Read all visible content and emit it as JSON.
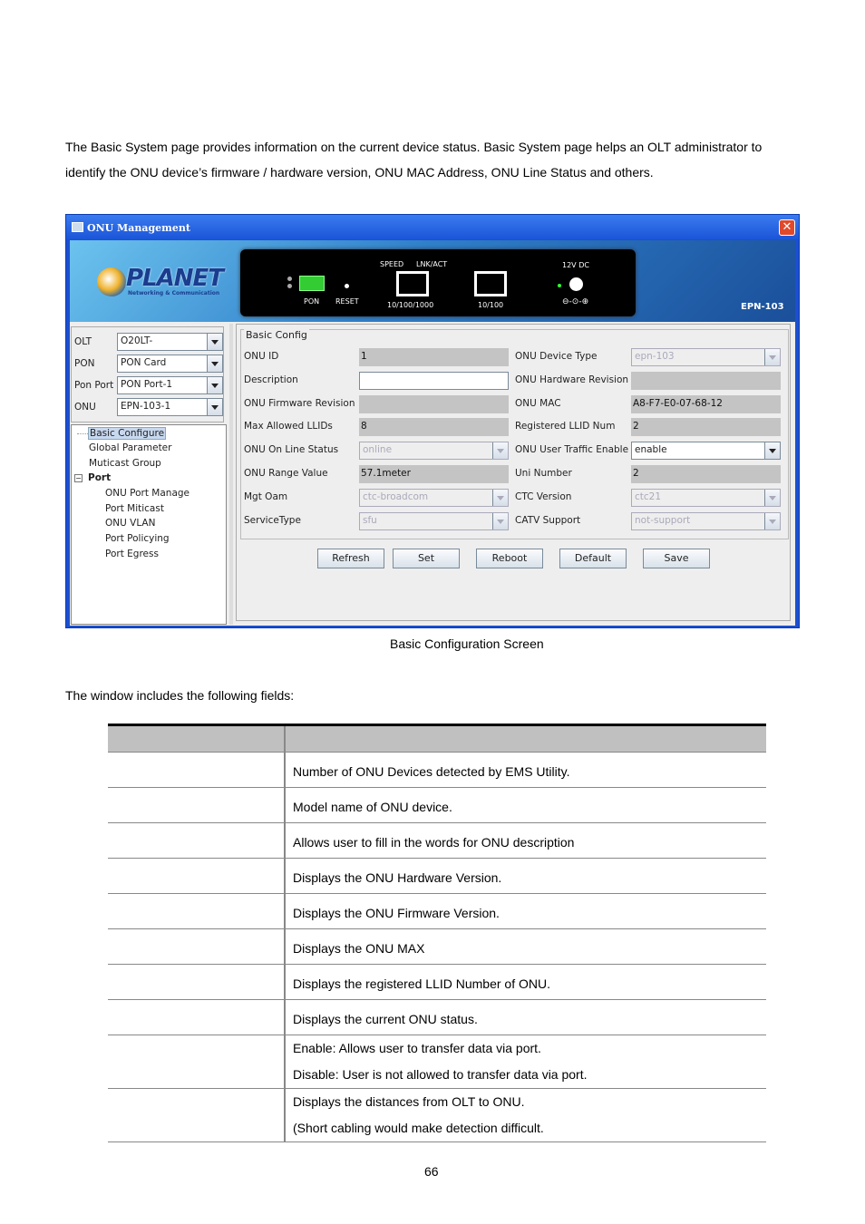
{
  "intro": {
    "line1": "The Basic System page provides information on the current device status. Basic System page helps an OLT administrator to",
    "line2": "identify the ONU device’s firmware / hardware version, ONU MAC Address, ONU Line Status and others."
  },
  "window": {
    "title": "ONU Management",
    "logo": {
      "brand": "PLANET",
      "tagline": "Networking & Communication"
    },
    "device": {
      "speed": "SPEED",
      "lnkact": "LNK/ACT",
      "pon": "PON",
      "reset": "RESET",
      "port1": "10/100/1000",
      "port2": "10/100",
      "power": "12V DC",
      "polarity": "⊖-⊙-⊕",
      "model": "EPN-103"
    },
    "selectors": [
      {
        "label": "OLT",
        "value": "O20LT-"
      },
      {
        "label": "PON",
        "value": "PON Card"
      },
      {
        "label": "Pon Port",
        "value": "PON Port-1"
      },
      {
        "label": "ONU",
        "value": "EPN-103-1"
      }
    ],
    "tree": {
      "basic": "Basic Configure",
      "global": "Global Parameter",
      "multicast": "Muticast Group",
      "port": "Port",
      "children": [
        "ONU Port Manage",
        "Port Miticast",
        "ONU VLAN",
        "Port Policying",
        "Port Egress"
      ]
    },
    "config": {
      "title": "Basic Config",
      "left": [
        {
          "label": "ONU ID",
          "value": "1",
          "type": "ro"
        },
        {
          "label": "Description",
          "value": "",
          "type": "edit"
        },
        {
          "label": "ONU Firmware Revision",
          "value": "",
          "type": "ro"
        },
        {
          "label": "Max Allowed LLIDs",
          "value": "8",
          "type": "ro"
        },
        {
          "label": "ONU On Line Status",
          "value": "online",
          "type": "dis"
        },
        {
          "label": "ONU Range Value",
          "value": "57.1meter",
          "type": "ro"
        },
        {
          "label": "Mgt Oam",
          "value": "ctc-broadcom",
          "type": "dis"
        },
        {
          "label": "ServiceType",
          "value": "sfu",
          "type": "dis"
        }
      ],
      "right": [
        {
          "label": "ONU Device Type",
          "value": "epn-103",
          "type": "dis"
        },
        {
          "label": "ONU Hardware Revision",
          "value": "",
          "type": "ro"
        },
        {
          "label": "ONU  MAC",
          "value": "A8-F7-E0-07-68-12",
          "type": "ro"
        },
        {
          "label": "Registered LLID Num",
          "value": "2",
          "type": "ro"
        },
        {
          "label": "ONU User Traffic Enable",
          "value": "enable",
          "type": "sel"
        },
        {
          "label": "Uni Number",
          "value": "2",
          "type": "ro"
        },
        {
          "label": "CTC Version",
          "value": "ctc21",
          "type": "dis"
        },
        {
          "label": "CATV Support",
          "value": "not-support",
          "type": "dis"
        }
      ],
      "buttons": [
        "Refresh",
        "Set",
        "Reboot",
        "Default",
        "Save"
      ]
    }
  },
  "caption": "Basic Configuration Screen",
  "fields_intro": "The window includes the following fields:",
  "table": {
    "rows": [
      [
        "Number of ONU Devices detected by EMS Utility."
      ],
      [
        "Model name of ONU device."
      ],
      [
        "Allows user to fill in the words for ONU description"
      ],
      [
        "Displays the ONU Hardware Version."
      ],
      [
        "Displays the ONU Firmware Version."
      ],
      [
        "Displays the ONU MAX"
      ],
      [
        "Displays the registered LLID Number of ONU."
      ],
      [
        "Displays the current ONU status."
      ],
      [
        "Enable: Allows user to transfer data via port.",
        "Disable: User is not allowed to transfer data via port."
      ],
      [
        "Displays the distances from OLT to ONU.",
        "(Short cabling would make detection difficult."
      ]
    ]
  },
  "page_number": "66"
}
